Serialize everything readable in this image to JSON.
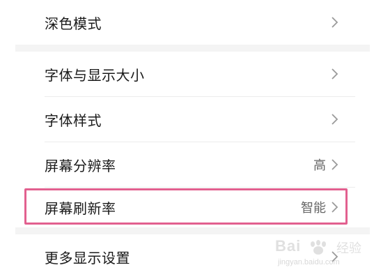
{
  "settings": {
    "items": [
      {
        "label": "深色模式",
        "value": ""
      },
      {
        "label": "字体与显示大小",
        "value": ""
      },
      {
        "label": "字体样式",
        "value": ""
      },
      {
        "label": "屏幕分辨率",
        "value": "高"
      },
      {
        "label": "屏幕刷新率",
        "value": "智能"
      },
      {
        "label": "更多显示设置",
        "value": ""
      }
    ]
  },
  "watermark": {
    "brand": "Bai",
    "brand_suffix": "经验",
    "url": "jingyan.baidu.com"
  },
  "colors": {
    "highlight": "#e2608f",
    "section_gap": "#f4f4f4",
    "divider": "#ececec"
  },
  "icons": {
    "chevron": "chevron-right-icon"
  }
}
